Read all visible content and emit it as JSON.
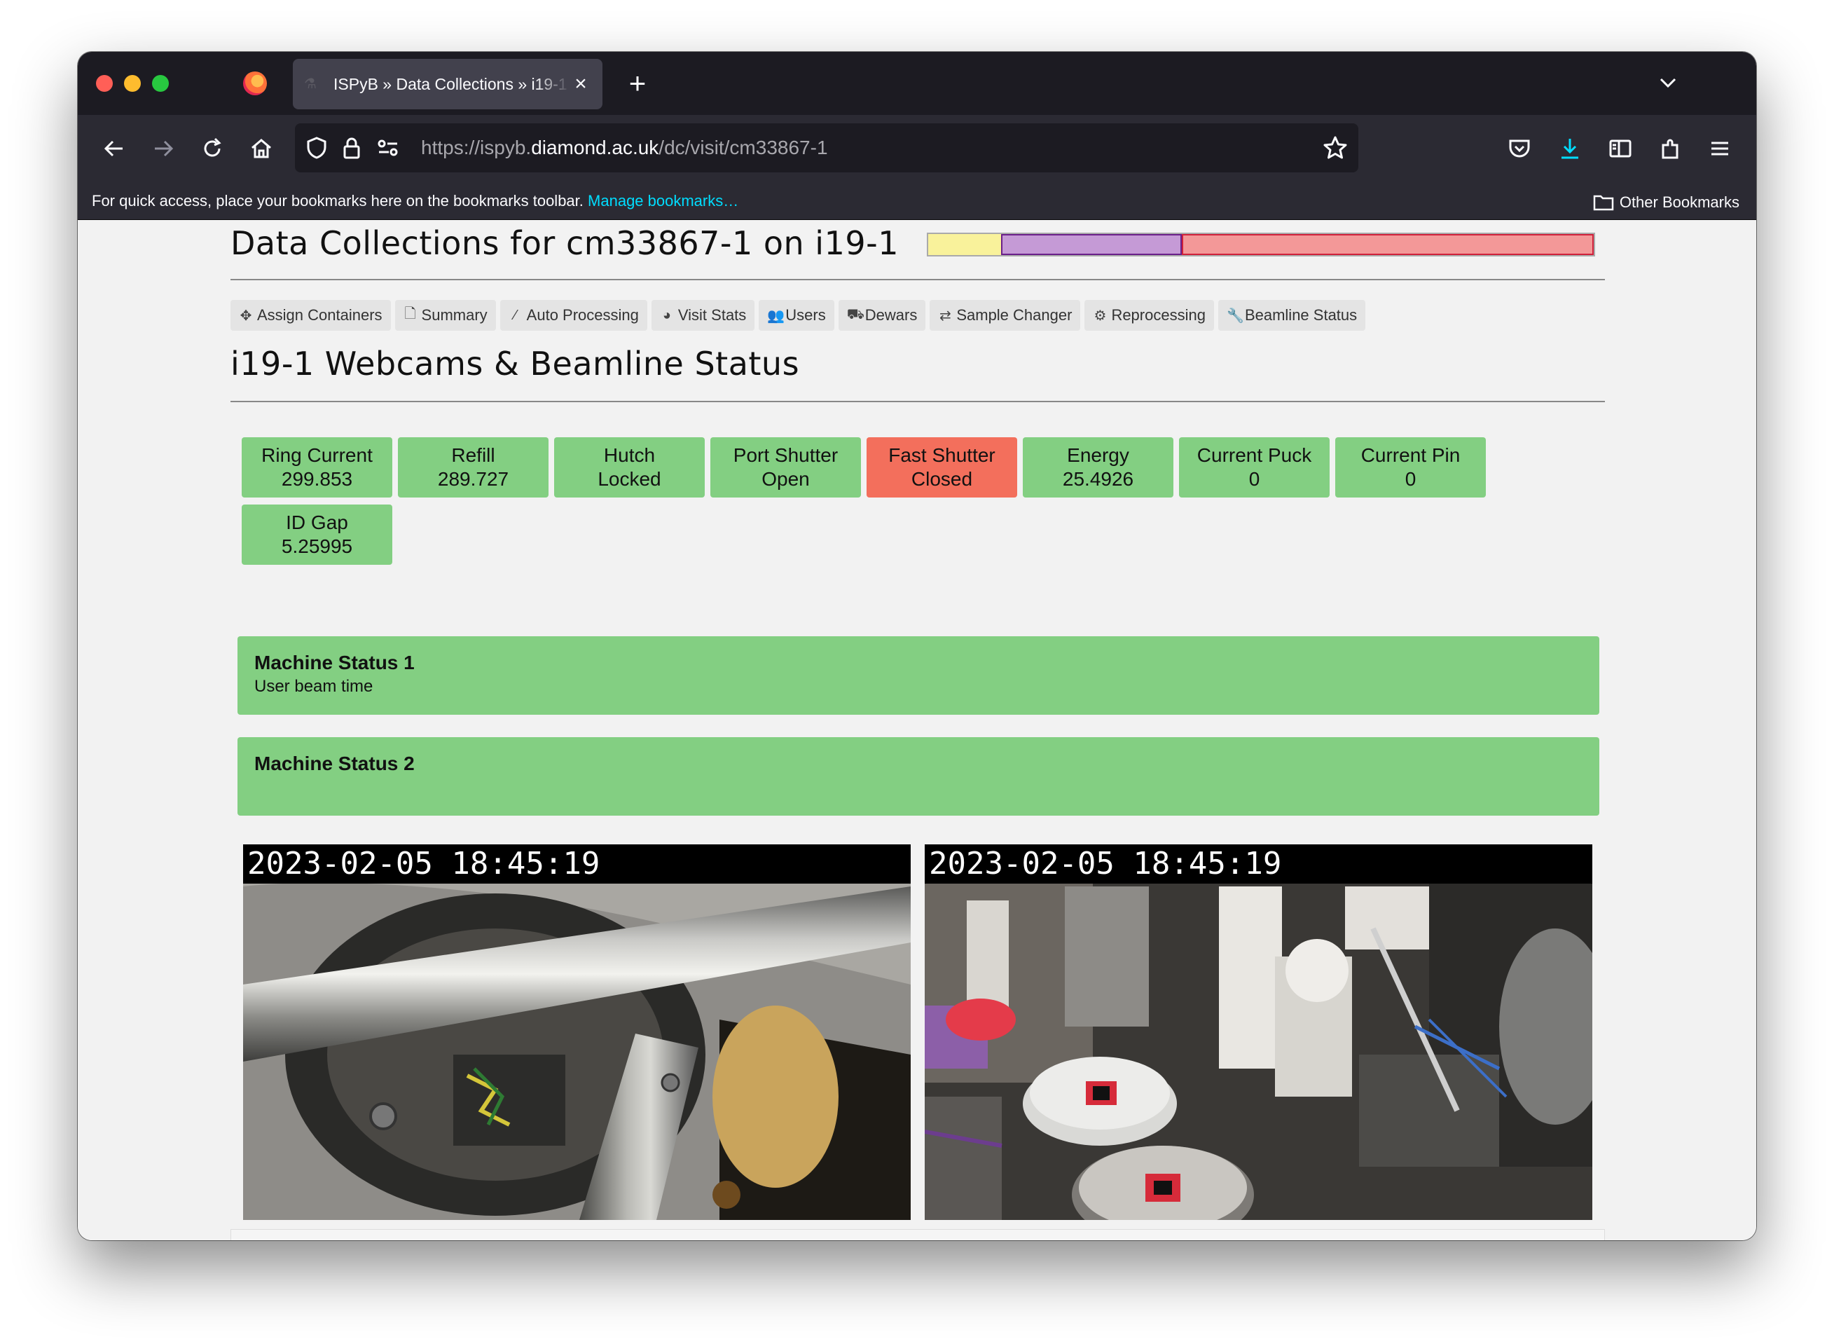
{
  "browser": {
    "tab_title": "ISPyB » Data Collections » i19-1",
    "tab_close": "×",
    "new_tab": "+",
    "url_prefix": "https://ispyb.",
    "url_host": "diamond.ac.uk",
    "url_path": "/dc/visit/cm33867-1",
    "bookmarks_hint": "For quick access, place your bookmarks here on the bookmarks toolbar.",
    "bookmarks_manage": "Manage bookmarks…",
    "other_bookmarks": "Other Bookmarks"
  },
  "header": {
    "title": "Data Collections for cm33867-1 on i19-1",
    "time_bar": [
      {
        "color": "#f9f29b",
        "fraction": 0.11
      },
      {
        "color": "#c59ad6",
        "fraction": 0.27
      },
      {
        "color": "#f39898",
        "fraction": 0.62
      }
    ]
  },
  "nav_tabs": [
    {
      "label": "Assign Containers",
      "icon": "move-icon",
      "glyph": "✥"
    },
    {
      "label": "Summary",
      "icon": "file-icon",
      "glyph": "🗋"
    },
    {
      "label": "Auto Processing",
      "icon": "wand-icon",
      "glyph": "⁄"
    },
    {
      "label": "Visit Stats",
      "icon": "pie-chart-icon",
      "glyph": "◕"
    },
    {
      "label": "Users",
      "icon": "users-icon",
      "glyph": "👥"
    },
    {
      "label": "Dewars",
      "icon": "truck-icon",
      "glyph": "⛟"
    },
    {
      "label": "Sample Changer",
      "icon": "exchange-icon",
      "glyph": "⇄"
    },
    {
      "label": "Reprocessing",
      "icon": "cog-icon",
      "glyph": "⚙"
    },
    {
      "label": "Beamline Status",
      "icon": "wrench-icon",
      "glyph": "🔧"
    }
  ],
  "section_title": "i19-1 Webcams & Beamline Status",
  "status_boxes": [
    {
      "label": "Ring Current",
      "value": "299.853",
      "state": "ok"
    },
    {
      "label": "Refill",
      "value": "289.727",
      "state": "ok"
    },
    {
      "label": "Hutch",
      "value": "Locked",
      "state": "ok"
    },
    {
      "label": "Port Shutter",
      "value": "Open",
      "state": "ok"
    },
    {
      "label": "Fast Shutter",
      "value": "Closed",
      "state": "alarm"
    },
    {
      "label": "Energy",
      "value": "25.4926",
      "state": "ok"
    },
    {
      "label": "Current Puck",
      "value": "0",
      "state": "ok"
    },
    {
      "label": "Current Pin",
      "value": "0",
      "state": "ok"
    },
    {
      "label": "ID Gap",
      "value": "5.25995",
      "state": "ok"
    }
  ],
  "machine_status": [
    {
      "title": "Machine Status 1",
      "text": "User beam time"
    },
    {
      "title": "Machine Status 2",
      "text": ""
    }
  ],
  "webcams": [
    {
      "timestamp": "2023-02-05 18:45:19"
    },
    {
      "timestamp": "2023-02-05 18:45:19"
    }
  ]
}
